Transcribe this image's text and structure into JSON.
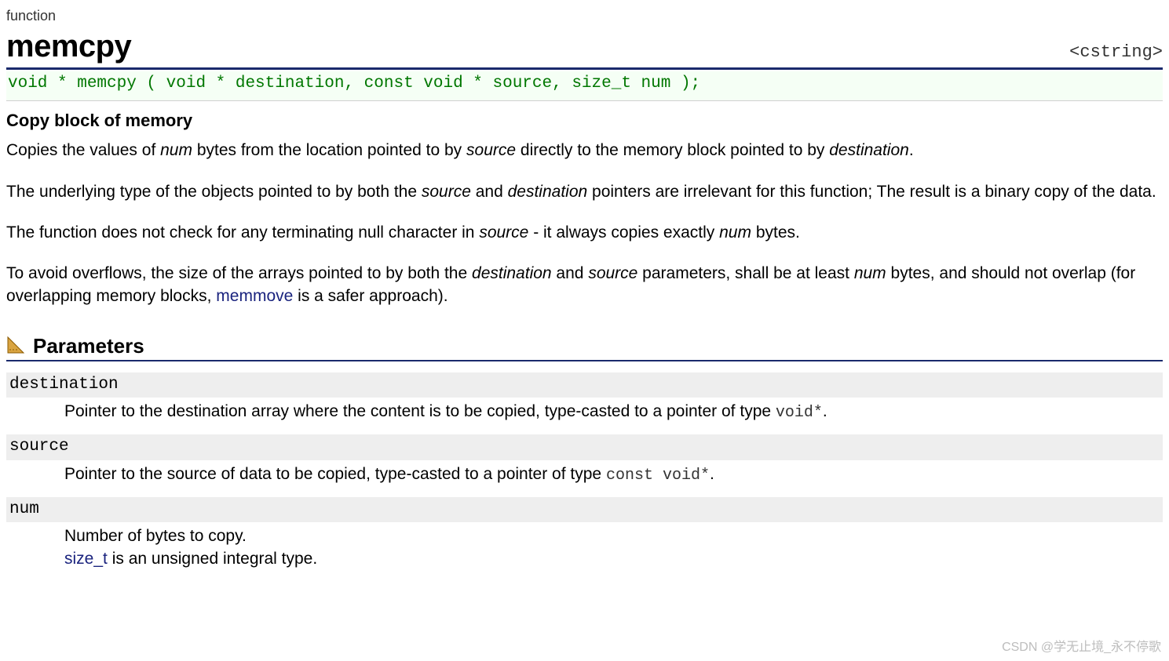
{
  "type_label": "function",
  "fn_name": "memcpy",
  "header_tag": "<cstring>",
  "signature": "void * memcpy ( void * destination, const void * source, size_t num );",
  "brief": "Copy block of memory",
  "desc": {
    "p1_a": "Copies the values of ",
    "p1_num": "num",
    "p1_b": " bytes from the location pointed to by ",
    "p1_src": "source",
    "p1_c": " directly to the memory block pointed to by ",
    "p1_dst": "destination",
    "p1_d": ".",
    "p2_a": "The underlying type of the objects pointed to by both the ",
    "p2_src": "source",
    "p2_b": " and ",
    "p2_dst": "destination",
    "p2_c": " pointers are irrelevant for this function; The result is a binary copy of the data.",
    "p3_a": "The function does not check for any terminating null character in ",
    "p3_src": "source",
    "p3_b": " - it always copies exactly ",
    "p3_num": "num",
    "p3_c": " bytes.",
    "p4_a": "To avoid overflows, the size of the arrays pointed to by both the ",
    "p4_dst": "destination",
    "p4_b": " and ",
    "p4_src": "source",
    "p4_c": " parameters, shall be at least ",
    "p4_num": "num",
    "p4_d": " bytes, and should not overlap (for overlapping memory blocks, ",
    "p4_link": "memmove",
    "p4_e": " is a safer approach)."
  },
  "params_heading": "Parameters",
  "params": {
    "p0_term": "destination",
    "p0_desc_a": "Pointer to the destination array where the content is to be copied, type-casted to a pointer of type ",
    "p0_code": "void*",
    "p0_desc_b": ".",
    "p1_term": "source",
    "p1_desc_a": "Pointer to the source of data to be copied, type-casted to a pointer of type ",
    "p1_code": "const void*",
    "p1_desc_b": ".",
    "p2_term": "num",
    "p2_desc_a": "Number of bytes to copy.",
    "p2_link": "size_t",
    "p2_desc_b": " is an unsigned integral type."
  },
  "watermark": "CSDN @学无止境_永不停歌"
}
